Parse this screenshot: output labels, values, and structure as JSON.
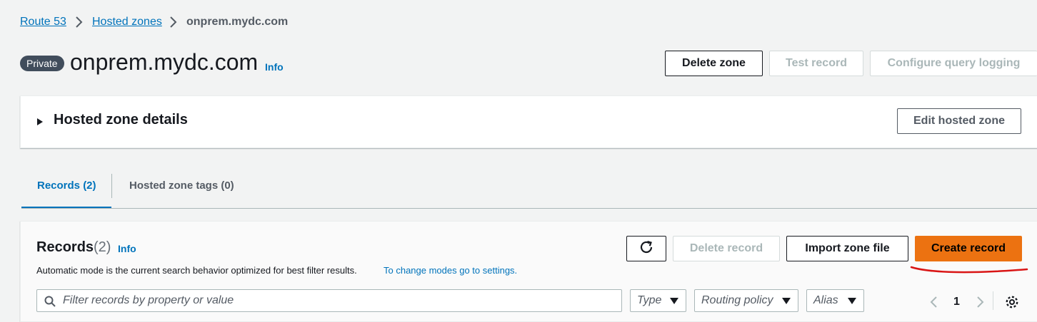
{
  "breadcrumb": {
    "items": [
      "Route 53",
      "Hosted zones"
    ],
    "current": "onprem.mydc.com"
  },
  "header": {
    "badge": "Private",
    "title": "onprem.mydc.com",
    "info": "Info",
    "buttons": {
      "delete_zone": "Delete zone",
      "test_record": "Test record",
      "configure_query_logging": "Configure query logging"
    }
  },
  "details_panel": {
    "title": "Hosted zone details",
    "edit_button": "Edit hosted zone"
  },
  "tabs": [
    {
      "label": "Records (2)",
      "active": true
    },
    {
      "label": "Hosted zone tags (0)",
      "active": false
    }
  ],
  "records_panel": {
    "title": "Records",
    "count": "(2)",
    "info": "Info",
    "description": "Automatic mode is the current search behavior optimized for best filter results.",
    "settings_link": "To change modes go to settings.",
    "buttons": {
      "delete_record": "Delete record",
      "import_zone_file": "Import zone file",
      "create_record": "Create record"
    },
    "search_placeholder": "Filter records by property or value",
    "filters": [
      "Type",
      "Routing policy",
      "Alias"
    ],
    "pagination": {
      "page": "1"
    }
  },
  "colors": {
    "link": "#0073bb",
    "primary": "#ec7211",
    "annotation": "#d91515"
  }
}
